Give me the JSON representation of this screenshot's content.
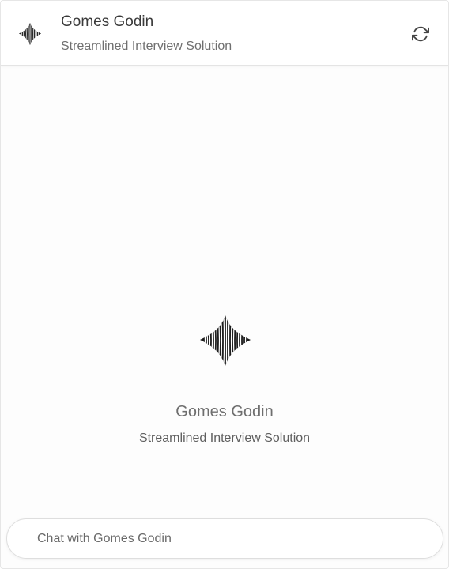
{
  "header": {
    "title": "Gomes Godin",
    "subtitle": "Streamlined Interview Solution",
    "logo_icon": "striped-diamond-icon",
    "refresh_icon": "refresh-icon"
  },
  "main": {
    "title": "Gomes Godin",
    "subtitle": "Streamlined Interview Solution",
    "logo_icon": "striped-diamond-icon"
  },
  "chat": {
    "placeholder": "Chat with Gomes Godin",
    "value": ""
  },
  "colors": {
    "background": "#ffffff",
    "border": "#e4e4e4",
    "text_primary": "#3a3a3a",
    "text_secondary": "#6f6f6f"
  }
}
